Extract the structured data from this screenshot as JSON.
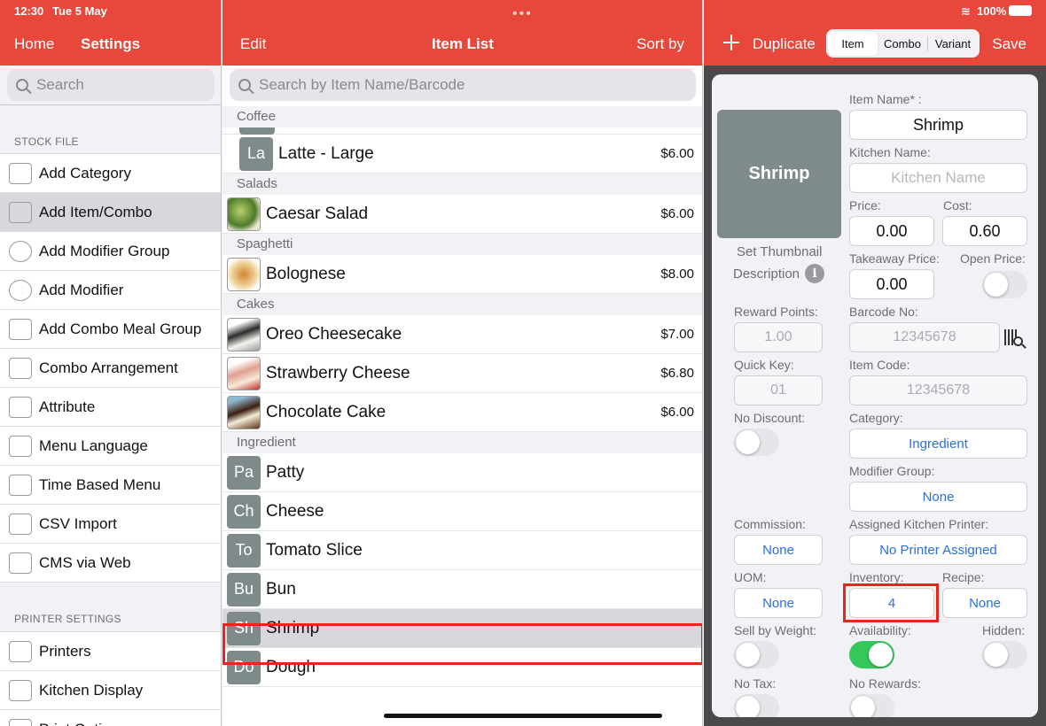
{
  "status": {
    "time": "12:30",
    "date": "Tue 5 May",
    "battery": "100%"
  },
  "left": {
    "nav": {
      "home": "Home",
      "title": "Settings"
    },
    "search_placeholder": "Search",
    "sections": [
      {
        "header": "STOCK FILE",
        "items": [
          {
            "label": "Add Category",
            "icon": "category-grid-icon"
          },
          {
            "label": "Add Item/Combo",
            "icon": "add-item-icon",
            "active": true
          },
          {
            "label": "Add Modifier Group",
            "icon": "modifier-group-icon"
          },
          {
            "label": "Add Modifier",
            "icon": "add-circle-icon"
          },
          {
            "label": "Add Combo Meal Group",
            "icon": "combo-meal-icon"
          },
          {
            "label": "Combo Arrangement",
            "icon": "combo-arrangement-icon"
          },
          {
            "label": "Attribute",
            "icon": "tag-icon"
          },
          {
            "label": "Menu Language",
            "icon": "language-icon"
          },
          {
            "label": "Time Based Menu",
            "icon": "clock-menu-icon"
          },
          {
            "label": "CSV Import",
            "icon": "csv-file-icon"
          },
          {
            "label": "CMS via Web",
            "icon": "web-cms-icon"
          }
        ]
      },
      {
        "header": "PRINTER SETTINGS",
        "items": [
          {
            "label": "Printers",
            "icon": "printer-icon"
          },
          {
            "label": "Kitchen Display",
            "icon": "kitchen-display-icon"
          },
          {
            "label": "Print Options",
            "icon": "print-options-icon"
          }
        ]
      }
    ]
  },
  "mid": {
    "nav": {
      "edit": "Edit",
      "title": "Item List",
      "sort": "Sort by"
    },
    "search_placeholder": "Search by Item Name/Barcode",
    "groups": [
      {
        "header": "Coffee",
        "items": [
          {
            "abbr": "La",
            "name": "Latte - Large",
            "price": "$6.00"
          }
        ]
      },
      {
        "header": "Salads",
        "items": [
          {
            "photo": "salad",
            "name": "Caesar Salad",
            "price": "$6.00"
          }
        ]
      },
      {
        "header": "Spaghetti",
        "items": [
          {
            "photo": "pasta",
            "name": "Bolognese",
            "price": "$8.00"
          }
        ]
      },
      {
        "header": "Cakes",
        "items": [
          {
            "photo": "oreo",
            "name": "Oreo Cheesecake",
            "price": "$7.00"
          },
          {
            "photo": "straw",
            "name": "Strawberry Cheese",
            "price": "$6.80"
          },
          {
            "photo": "choc",
            "name": "Chocolate Cake",
            "price": "$6.00"
          }
        ]
      },
      {
        "header": "Ingredient",
        "items": [
          {
            "abbr": "Pa",
            "name": "Patty",
            "price": ""
          },
          {
            "abbr": "Ch",
            "name": "Cheese",
            "price": ""
          },
          {
            "abbr": "To",
            "name": "Tomato Slice",
            "price": ""
          },
          {
            "abbr": "Bu",
            "name": "Bun",
            "price": ""
          },
          {
            "abbr": "Sh",
            "name": "Shrimp",
            "price": "",
            "selected": true
          },
          {
            "abbr": "Do",
            "name": "Dough",
            "price": ""
          }
        ]
      }
    ]
  },
  "right": {
    "nav": {
      "duplicate": "Duplicate",
      "seg_item": "Item",
      "seg_combo": "Combo",
      "seg_variant": "Variant",
      "save": "Save"
    },
    "thumb_text": "Shrimp",
    "set_thumbnail": "Set Thumbnail",
    "description": "Description",
    "info_glyph": "i",
    "item_name_label": "Item Name* :",
    "item_name_value": "Shrimp",
    "kitchen_name_label": "Kitchen Name:",
    "kitchen_name_placeholder": "Kitchen Name",
    "price_label": "Price:",
    "price_value": "0.00",
    "cost_label": "Cost:",
    "cost_value": "0.60",
    "takeaway_label": "Takeaway Price:",
    "takeaway_value": "0.00",
    "open_price_label": "Open Price:",
    "reward_label": "Reward Points:",
    "reward_value": "1.00",
    "barcode_label": "Barcode No:",
    "barcode_value": "12345678",
    "quickkey_label": "Quick Key:",
    "quickkey_value": "01",
    "itemcode_label": "Item Code:",
    "itemcode_value": "12345678",
    "nodiscount_label": "No Discount:",
    "category_label": "Category:",
    "category_value": "Ingredient",
    "modgroup_label": "Modifier Group:",
    "modgroup_value": "None",
    "commission_label": "Commission:",
    "commission_value": "None",
    "kitchen_printer_label": "Assigned Kitchen Printer:",
    "kitchen_printer_value": "No Printer Assigned",
    "uom_label": "UOM:",
    "uom_value": "None",
    "inventory_label": "Inventory:",
    "inventory_value": "4",
    "recipe_label": "Recipe:",
    "recipe_value": "None",
    "sellweight_label": "Sell by Weight:",
    "availability_label": "Availability:",
    "hidden_label": "Hidden:",
    "notax_label": "No Tax:",
    "norewards_label": "No Rewards:"
  },
  "colors": {
    "accent": "#e8483c",
    "highlight": "#e8241b",
    "link": "#2a6fdb",
    "toggle_on": "#34c759"
  }
}
